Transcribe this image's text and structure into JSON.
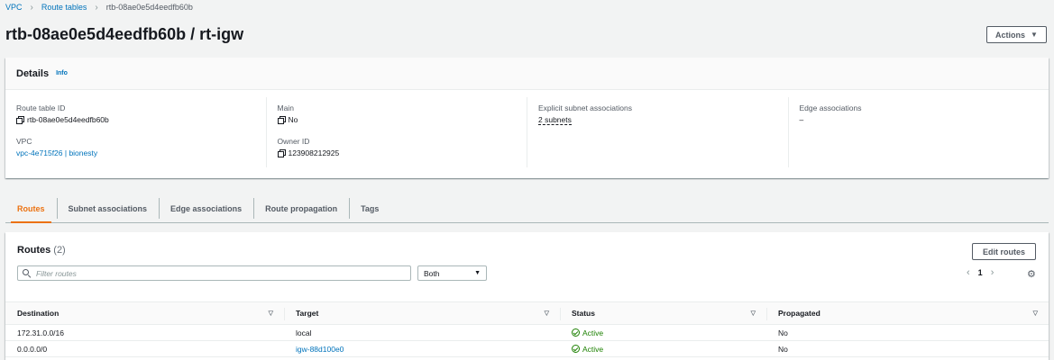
{
  "breadcrumb": {
    "items": [
      "VPC",
      "Route tables"
    ],
    "current": "rtb-08ae0e5d4eedfb60b"
  },
  "page": {
    "title": "rtb-08ae0e5d4eedfb60b / rt-igw",
    "actions_label": "Actions"
  },
  "details": {
    "title": "Details",
    "info_label": "Info",
    "fields": {
      "route_table_id": {
        "label": "Route table ID",
        "value": "rtb-08ae0e5d4eedfb60b"
      },
      "vpc": {
        "label": "VPC",
        "value": "vpc-4e715f26 | bionesty"
      },
      "main": {
        "label": "Main",
        "value": "No"
      },
      "owner_id": {
        "label": "Owner ID",
        "value": "123908212925"
      },
      "explicit_subnet": {
        "label": "Explicit subnet associations",
        "value": "2 subnets"
      },
      "edge": {
        "label": "Edge associations",
        "value": "–"
      }
    }
  },
  "tabs": [
    "Routes",
    "Subnet associations",
    "Edge associations",
    "Route propagation",
    "Tags"
  ],
  "routes": {
    "title": "Routes",
    "count": "(2)",
    "edit_label": "Edit routes",
    "filter_placeholder": "Filter routes",
    "select_value": "Both",
    "page_number": "1",
    "columns": [
      "Destination",
      "Target",
      "Status",
      "Propagated"
    ],
    "rows": [
      {
        "destination": "172.31.0.0/16",
        "target": "local",
        "target_is_link": false,
        "status": "Active",
        "propagated": "No"
      },
      {
        "destination": "0.0.0.0/0",
        "target": "igw-88d100e0",
        "target_is_link": true,
        "status": "Active",
        "propagated": "No"
      }
    ]
  },
  "colors": {
    "link": "#0073bb",
    "accent": "#ec7211",
    "success": "#1d8102"
  }
}
